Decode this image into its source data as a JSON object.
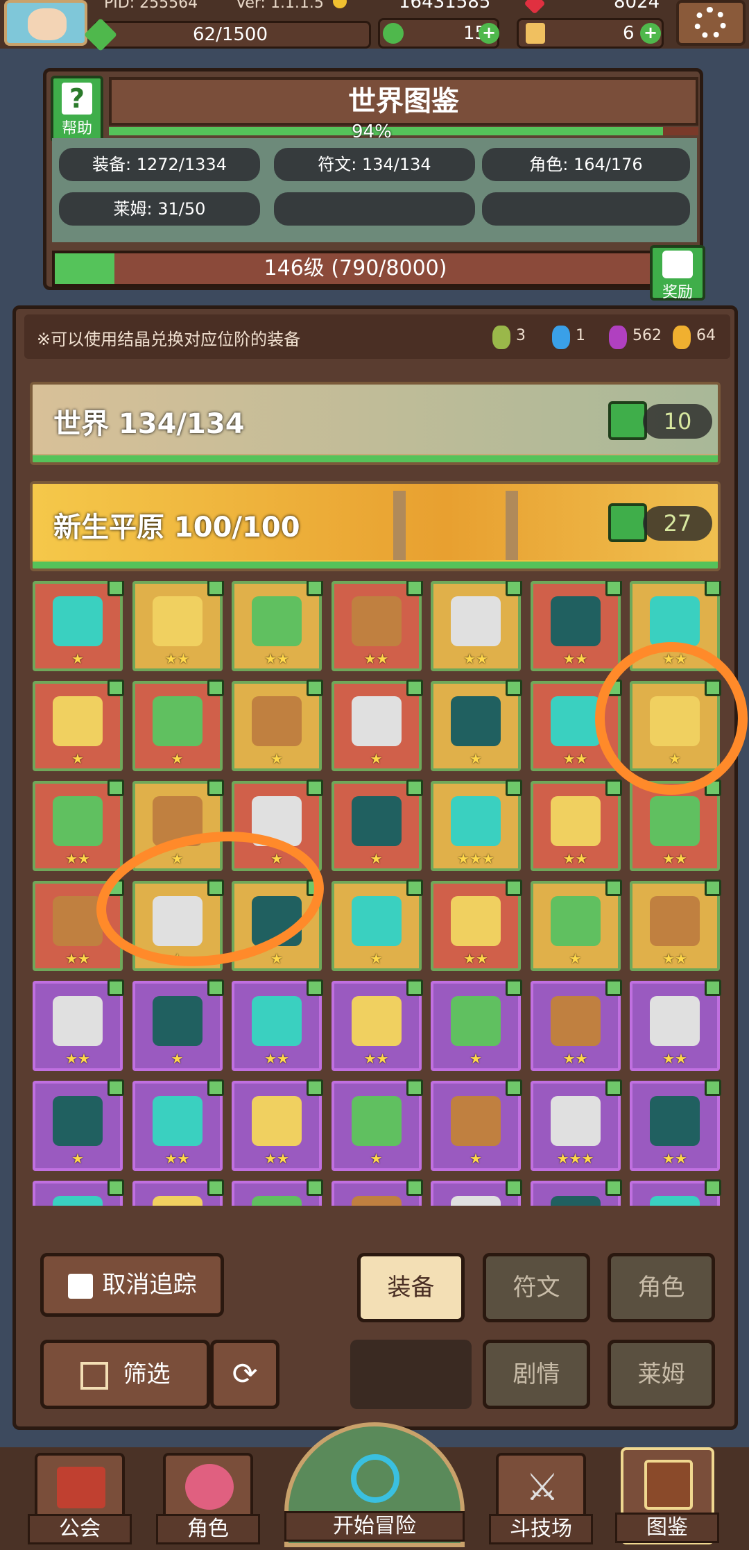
{
  "topbar": {
    "pid": "PID: 255564",
    "version": "Ver: 1.1.1.5",
    "gold": "16431585",
    "gems": "8024",
    "exp": "62/1500",
    "clover": "15",
    "bag": "6"
  },
  "atlas": {
    "title": "世界图鉴",
    "help_label": "帮助",
    "progress_percent": "94%",
    "progress_value": 0.94,
    "stats": [
      "装备: 1272/1334",
      "符文: 134/134",
      "角色: 164/176",
      "莱姆: 31/50"
    ],
    "level_text": "146级 (790/8000)",
    "level_fraction": 0.099,
    "reward_label": "奖励"
  },
  "panel": {
    "notice": "※可以使用结晶兑换对应位阶的装备",
    "crystals": [
      {
        "color": "#9ab84a",
        "count": "3"
      },
      {
        "color": "#3aa0e8",
        "count": "1"
      },
      {
        "color": "#b040c0",
        "count": "562"
      },
      {
        "color": "#f0b030",
        "count": "64"
      }
    ],
    "world_banner": {
      "label": "世界 134/134",
      "count": "10"
    },
    "region_banner": {
      "label": "新生平原 100/100",
      "count": "27"
    }
  },
  "grid": {
    "rows": [
      {
        "colors": [
          "red",
          "gold",
          "gold",
          "red",
          "gold",
          "red",
          "gold"
        ],
        "stars": [
          "★",
          "★★",
          "★★",
          "★★",
          "★★",
          "★★",
          "★★"
        ]
      },
      {
        "colors": [
          "red",
          "red",
          "gold",
          "red",
          "gold",
          "red",
          "gold"
        ],
        "stars": [
          "★",
          "★",
          "★",
          "★",
          "★",
          "★★",
          "★"
        ]
      },
      {
        "colors": [
          "red",
          "gold",
          "red",
          "red",
          "gold",
          "red",
          "red"
        ],
        "stars": [
          "★★",
          "★",
          "★",
          "★",
          "★★★",
          "★★",
          "★★"
        ]
      },
      {
        "colors": [
          "red",
          "gold",
          "gold",
          "gold",
          "red",
          "gold",
          "gold"
        ],
        "stars": [
          "★★",
          "★",
          "★",
          "★",
          "★★",
          "★",
          "★★"
        ]
      },
      {
        "colors": [
          "purple",
          "purple",
          "purple",
          "purple",
          "purple",
          "purple",
          "purple"
        ],
        "stars": [
          "★★",
          "★",
          "★★",
          "★★",
          "★",
          "★★",
          "★★"
        ]
      },
      {
        "colors": [
          "purple",
          "purple",
          "purple",
          "purple",
          "purple",
          "purple",
          "purple"
        ],
        "stars": [
          "★",
          "★★",
          "★★",
          "★",
          "★",
          "★★★",
          "★★"
        ]
      },
      {
        "colors": [
          "purple",
          "purple",
          "purple",
          "purple",
          "purple",
          "purple",
          "purple"
        ],
        "stars": [
          "",
          "",
          "",
          "",
          "",
          "",
          ""
        ]
      }
    ],
    "icon_colors": [
      "#3ad0c0",
      "#f0d060",
      "#60c060",
      "#c08040",
      "#e0e0e0",
      "#206060"
    ]
  },
  "controls": {
    "untrack": "取消追踪",
    "filter": "筛选",
    "tabs": [
      "装备",
      "符文",
      "角色",
      "剧情",
      "莱姆"
    ]
  },
  "nav": {
    "items": [
      "公会",
      "角色",
      "开始冒险",
      "斗技场",
      "图鉴"
    ]
  }
}
